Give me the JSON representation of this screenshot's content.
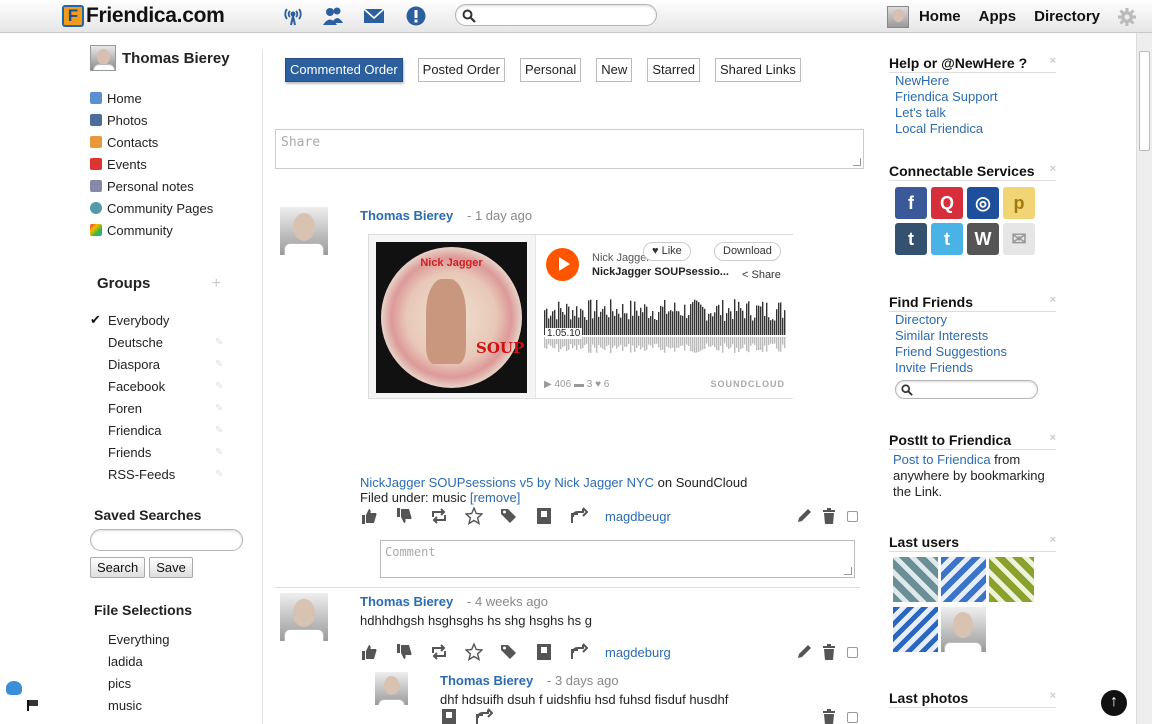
{
  "header": {
    "logo_letter": "F",
    "logo_text": "Friendica.com",
    "nav_icons": [
      "network-icon",
      "contacts-icon",
      "messages-icon",
      "notifications-icon"
    ],
    "search_placeholder": "",
    "links": [
      "Home",
      "Apps",
      "Directory"
    ]
  },
  "profile": {
    "name": "Thomas Bierey"
  },
  "sidebar": {
    "nav": [
      {
        "label": "Home",
        "icon": "home-icon",
        "color": "#5a8fd0"
      },
      {
        "label": "Photos",
        "icon": "photos-icon",
        "color": "#4a6d9a"
      },
      {
        "label": "Contacts",
        "icon": "contacts-icon",
        "color": "#e89a3a"
      },
      {
        "label": "Events",
        "icon": "events-icon",
        "color": "#d33"
      },
      {
        "label": "Personal notes",
        "icon": "notes-icon",
        "color": "#88a"
      },
      {
        "label": "Community Pages",
        "icon": "community-pages-icon",
        "color": "#59a"
      },
      {
        "label": "Community",
        "icon": "rainbow-icon",
        "color": "#e66"
      }
    ],
    "groups_title": "Groups",
    "groups": [
      "Everybody",
      "Deutsche",
      "Diaspora",
      "Facebook",
      "Foren",
      "Friendica",
      "Friends",
      "RSS-Feeds"
    ],
    "saved_title": "Saved Searches",
    "search_button": "Search",
    "save_button": "Save",
    "files_title": "File Selections",
    "files": [
      "Everything",
      "ladida",
      "pics",
      "music"
    ]
  },
  "tabs": [
    "Commented Order",
    "Posted Order",
    "Personal",
    "New",
    "Starred",
    "Shared Links"
  ],
  "share_placeholder": "Share",
  "posts": [
    {
      "author": "Thomas Bierey",
      "ago": "- 1 day ago",
      "embed": {
        "art_title": "Nick Jagger",
        "art_sub": "SOUP",
        "artist": "Nick Jagger",
        "track": "NickJagger SOUPsessio...",
        "like": "Like",
        "download": "Download",
        "share": "Share",
        "time": "1.05.10",
        "plays": "406",
        "comments": "3",
        "likes": "6",
        "brand": "SOUNDCLOUD"
      },
      "link_text": "NickJagger SOUPsessions v5 by Nick Jagger NYC",
      "link_suffix": " on SoundCloud",
      "filed": "Filed under: music ",
      "remove": "[remove]",
      "tag_user": "magdbeugr",
      "comment_placeholder": "Comment"
    },
    {
      "author": "Thomas Bierey",
      "ago": "- 4 weeks ago",
      "text": "hdhhdhgsh hsghsghs hs shg hsghs hs g",
      "tag_user": "magdeburg"
    },
    {
      "author": "Thomas Bierey",
      "ago": "- 3 days ago",
      "text": "dhf hdsuifh dsuh f uidshfiu hsd fuhsd fisduf husdhf"
    }
  ],
  "right": {
    "help_title": "Help or @NewHere ?",
    "help_links": [
      "NewHere",
      "Friendica Support",
      "Let's talk",
      "Local Friendica"
    ],
    "services_title": "Connectable Services",
    "services": [
      {
        "name": "facebook-icon",
        "glyph": "f",
        "color": "#3b5998"
      },
      {
        "name": "qiita-icon",
        "glyph": "Q",
        "color": "#d62e3a"
      },
      {
        "name": "statusnet-icon",
        "glyph": "◎",
        "color": "#1d4f9c"
      },
      {
        "name": "posterous-icon",
        "glyph": "p",
        "color": "#f1d473"
      },
      {
        "name": "tumblr-icon",
        "glyph": "t",
        "color": "#34526f"
      },
      {
        "name": "twitter-icon",
        "glyph": "t",
        "color": "#4ab3e6"
      },
      {
        "name": "wordpress-icon",
        "glyph": "W",
        "color": "#555"
      },
      {
        "name": "email-icon",
        "glyph": "✉",
        "color": "#e6e6e6"
      }
    ],
    "find_title": "Find Friends",
    "find_links": [
      "Directory",
      "Similar Interests",
      "Friend Suggestions",
      "Invite Friends"
    ],
    "postit_title": "PostIt to Friendica",
    "postit_link": "Post to Friendica",
    "postit_text": " from anywhere by bookmarking the Link.",
    "lastusers_title": "Last users",
    "lastphotos_title": "Last photos"
  }
}
